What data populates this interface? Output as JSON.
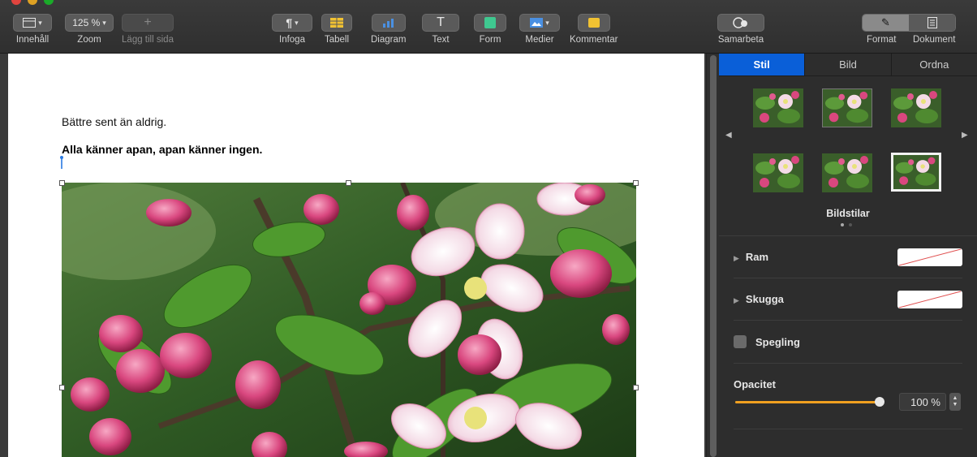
{
  "toolbar": {
    "sidebar_label": "Innehåll",
    "zoom_value": "125 %",
    "zoom_label": "Zoom",
    "addpage_label": "Lägg till sida",
    "insert_label": "Infoga",
    "table_label": "Tabell",
    "chart_label": "Diagram",
    "text_label": "Text",
    "shape_label": "Form",
    "media_label": "Medier",
    "comment_label": "Kommentar",
    "collab_label": "Samarbeta",
    "format_label": "Format",
    "document_label": "Dokument",
    "icons": [
      "sidebar-icon",
      "paragraph-icon",
      "table-icon",
      "chart-icon",
      "text-icon",
      "shape-icon",
      "media-icon",
      "comment-icon",
      "collaborate-icon",
      "format-brush-icon",
      "document-icon"
    ]
  },
  "document": {
    "line1": "Bättre sent än aldrig.",
    "line2": "Alla känner apan, apan känner ingen.",
    "image_subject": "apple-blossom-photo"
  },
  "inspector": {
    "tabs": [
      "Stil",
      "Bild",
      "Ordna"
    ],
    "active_tab": "Stil",
    "styles_caption": "Bildstilar",
    "border_label": "Ram",
    "shadow_label": "Skugga",
    "reflection_label": "Spegling",
    "reflection_checked": false,
    "opacity_label": "Opacitet",
    "opacity_value": "100 %",
    "opacity_fraction": 1.0,
    "selected_style_index": 5
  },
  "colors": {
    "accent": "#0a5fd8",
    "slider": "#f0a020",
    "toolbar_yellow": "#f1c232",
    "toolbar_blue": "#4a90e2",
    "toolbar_green": "#3fc890"
  }
}
